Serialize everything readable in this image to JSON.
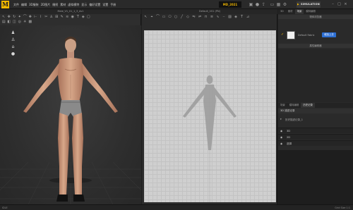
{
  "app": {
    "logo": "M"
  },
  "menu": [
    "文件",
    "编辑",
    "3D服装",
    "2D图片",
    "缝纫",
    "素材",
    "虚拟模特",
    "显示",
    "偏好设置",
    "设置",
    "手册"
  ],
  "version_badge": "MD_2021",
  "toolbar_right": {
    "simulation_label": "SIMULATION",
    "simulation_icon": "play-icon"
  },
  "window": {
    "minimize": "–",
    "maximize": "□",
    "close": "×"
  },
  "panel_3d": {
    "title": "Male_V1_01_1_3_Av1",
    "side_icons": [
      "avatar-icon",
      "garment-icon",
      "hanger-icon",
      "head-icon"
    ]
  },
  "panel_2d": {
    "title": "Default_V01 (PN)"
  },
  "right_panel": {
    "top_tabs": [
      "3D",
      "素材",
      "场景",
      "模特编辑"
    ],
    "object_browser_header": "物体浏览器",
    "fabric": {
      "name": "Default Fabric",
      "button": "增加上去"
    },
    "property_header": "属性编辑器",
    "lower_tabs": [
      "场景",
      "模特编辑",
      "历史记录"
    ],
    "history": {
      "header": "3D 描述记录",
      "item": "历史描述记录_1",
      "rows": [
        {
          "label": "3D"
        },
        {
          "label": "2D"
        },
        {
          "label": "选择"
        }
      ]
    }
  },
  "status": {
    "left": "IDLE",
    "right": "Grid Size 1:1"
  },
  "colors": {
    "accent": "#f0b600",
    "button_blue": "#2d6fd3",
    "canvas_2d": "#cfcfcf",
    "panel_bg": "#2e2e2e"
  }
}
